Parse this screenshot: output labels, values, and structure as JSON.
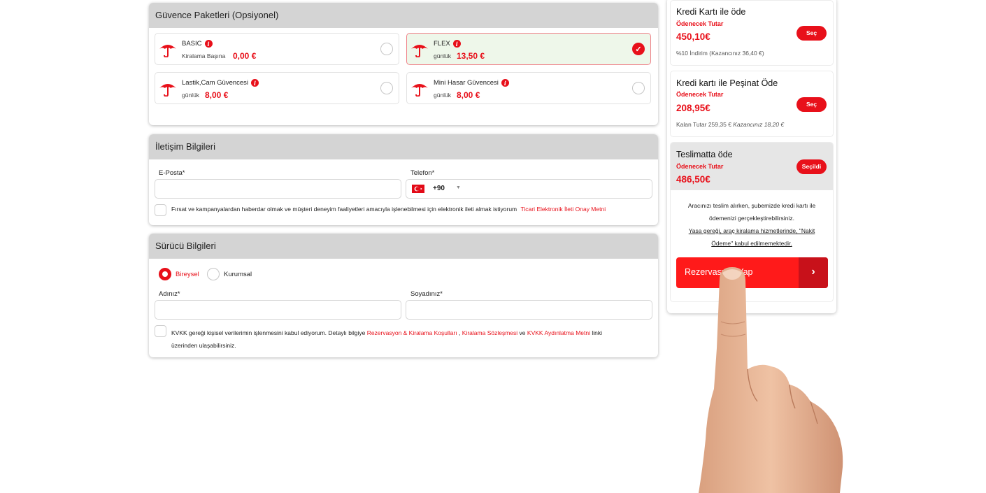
{
  "guarantee": {
    "title": "Güvence Paketleri (Opsiyonel)",
    "packages": [
      {
        "name": "BASIC",
        "unit": "Kiralama Başına",
        "price": "0,00 €",
        "selected": false
      },
      {
        "name": "FLEX",
        "unit": "günlük",
        "price": "13,50 €",
        "selected": true
      },
      {
        "name": "Lastik,Cam Güvencesi",
        "unit": "günlük",
        "price": "8,00 €",
        "selected": false
      },
      {
        "name": "Mini Hasar Güvencesi",
        "unit": "günlük",
        "price": "8,00 €",
        "selected": false
      }
    ]
  },
  "contact": {
    "title": "İletişim Bilgileri",
    "email_label": "E-Posta*",
    "email_value": "",
    "phone_label": "Telefon*",
    "phone_code": "+90",
    "phone_value": "",
    "consent_text": "Fırsat ve kampanyalardan haberdar olmak ve müşteri deneyim faaliyetleri amacıyla işlenebilmesi için elektronik ileti almak istiyorum",
    "consent_link": "Ticari Elektronik İleti Onay Metni"
  },
  "driver": {
    "title": "Sürücü Bilgileri",
    "type_individual": "Bireysel",
    "type_corporate": "Kurumsal",
    "selected_type": "Bireysel",
    "first_name_label": "Adınız*",
    "first_name_value": "",
    "last_name_label": "Soyadınız*",
    "last_name_value": "",
    "kvkk_text1": "KVKK gereği kişisel verilerimin işlenmesini kabul ediyorum. Detaylı bilgiye",
    "kvkk_link1": "Rezervasyon & Kiralama Koşulları",
    "kvkk_sep1": ",",
    "kvkk_link2": "Kiralama Sözleşmesi",
    "kvkk_sep2": "ve",
    "kvkk_link3": "KVKK Aydınlatma Metni",
    "kvkk_text2": "linki",
    "kvkk_text3": "üzerinden ulaşabilirsiniz."
  },
  "payment": {
    "options": [
      {
        "title": "Kredi Kartı ile öde",
        "amount_label": "Ödenecek Tutar",
        "amount": "450,10€",
        "button": "Seç",
        "note": "%10 İndirim (Kazancınız 36,40 €)"
      },
      {
        "title": "Kredi kartı ile Peşinat Öde",
        "amount_label": "Ödenecek Tutar",
        "amount": "208,95€",
        "button": "Seç",
        "note_prefix": "Kalan Tutar 259,35 €",
        "note_suffix": "Kazancınız 18,20 €"
      },
      {
        "title": "Teslimatta öde",
        "amount_label": "Ödenecek Tutar",
        "amount": "486,50€",
        "button": "Seçildi"
      }
    ],
    "delivery_info_line1": "Aracınızı teslim alırken, şubemizde kredi kartı ile",
    "delivery_info_line2": "ödemenizi gerçekleştirebilirsiniz.",
    "delivery_law_line1": "Yasa gereği, araç kiralama hizmetlerinde, \"Nakit",
    "delivery_law_line2": "Ödeme\" kabul edilmemektedir.",
    "reserve_button": "Rezervasyon Yap",
    "reserve_arrow": "›"
  },
  "colors": {
    "accent": "#e8101a",
    "header_bg": "#d4d4d4",
    "selected_bg": "#eef7ea"
  },
  "icons": [
    "umbrella-icon",
    "info-icon",
    "check-icon",
    "turkey-flag-icon",
    "caret-down-icon",
    "chevron-right-icon"
  ]
}
